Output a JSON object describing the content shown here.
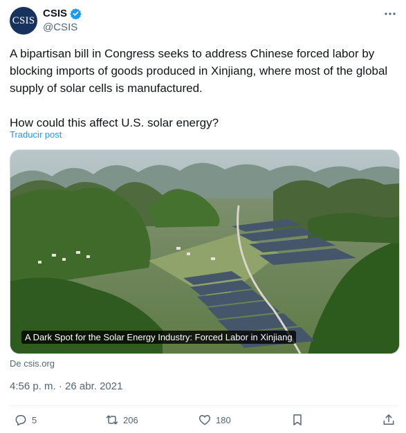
{
  "author": {
    "avatar_text": "CSIS",
    "display_name": "CSIS",
    "handle": "@CSIS",
    "verified_icon": "verified-badge-icon",
    "brand_color": "#17325c",
    "verified_color": "#1d9bf0"
  },
  "tweet": {
    "text": "A bipartisan bill in Congress seeks to address Chinese forced labor by blocking imports of goods produced in Xinjiang, where most of the global supply of solar cells is manufactured.\n\nHow could this affect U.S. solar energy?",
    "translate_label": "Traducir post"
  },
  "card": {
    "caption": "A Dark Spot for the Solar Energy Industry: Forced Labor in Xinjiang",
    "source": "De csis.org"
  },
  "meta": {
    "timestamp": "4:56 p. m. · 26 abr. 2021"
  },
  "actions": {
    "replies": "5",
    "reposts": "206",
    "likes": "180"
  },
  "colors": {
    "accent": "#1d9bf0",
    "muted": "#536471"
  }
}
